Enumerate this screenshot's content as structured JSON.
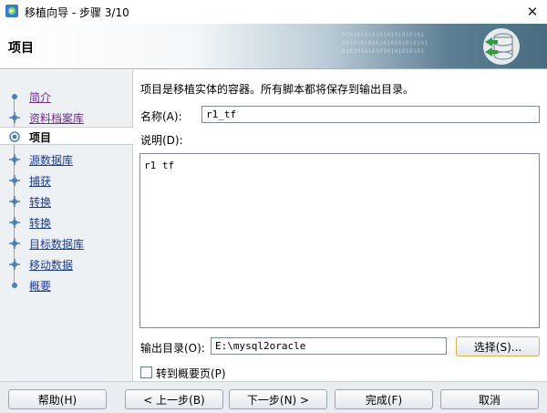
{
  "window": {
    "title": "移植向导 - 步骤 3/10",
    "close_glyph": "✕"
  },
  "banner": {
    "title": "项目",
    "binary_lines": [
      "0101010101010101010101",
      "10101010101010101010101",
      "0101010101010101010101"
    ]
  },
  "steps": [
    {
      "label": "简介",
      "state": "visited"
    },
    {
      "label": "资料档案库",
      "state": "visited"
    },
    {
      "label": "项目",
      "state": "current"
    },
    {
      "label": "源数据库",
      "state": "todo"
    },
    {
      "label": "捕获",
      "state": "todo"
    },
    {
      "label": "转换",
      "state": "todo"
    },
    {
      "label": "转换",
      "state": "todo"
    },
    {
      "label": "目标数据库",
      "state": "todo"
    },
    {
      "label": "移动数据",
      "state": "todo"
    },
    {
      "label": "概要",
      "state": "todo"
    }
  ],
  "main": {
    "description": "项目是移植实体的容器。所有脚本都将保存到输出目录。",
    "name_label": "名称(A):",
    "name_value": "r1_tf",
    "desc_label": "说明(D):",
    "desc_value": "r1 tf",
    "output_label": "输出目录(O):",
    "output_value": "E:\\mysql2oracle",
    "choose_button": "选择(S)...",
    "jump_checkbox_label": "转到概要页(P)",
    "jump_checked": false
  },
  "footer": {
    "help": "帮助(H)",
    "back": "< 上一步(B)",
    "next": "下一步(N) >",
    "finish": "完成(F)",
    "cancel": "取消"
  }
}
